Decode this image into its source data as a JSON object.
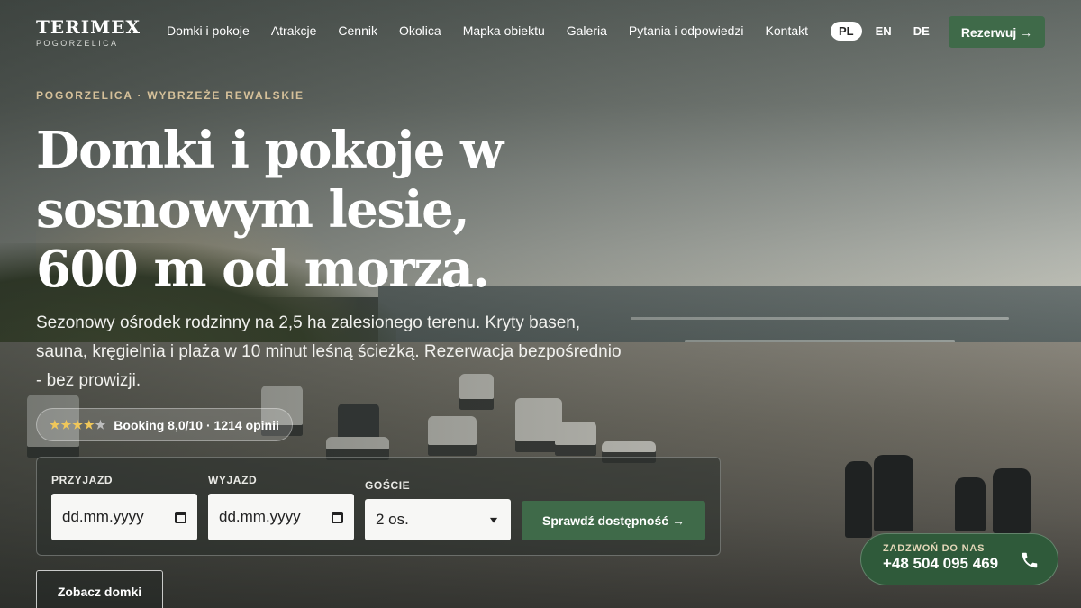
{
  "brand": {
    "name": "TERIMEX",
    "subtitle": "POGORZELICA"
  },
  "nav": {
    "items": [
      "Domki i pokoje",
      "Atrakcje",
      "Cennik",
      "Okolica",
      "Mapka obiektu",
      "Galeria",
      "Pytania i odpowiedzi",
      "Kontakt"
    ]
  },
  "languages": {
    "items": [
      "PL",
      "EN",
      "DE"
    ],
    "active": "PL"
  },
  "header": {
    "reserve_label": "Rezerwuj →"
  },
  "hero": {
    "eyebrow": "POGORZELICA · WYBRZEŻE REWALSKIE",
    "headline": [
      "Domki i pokoje w",
      "sosnowym lesie,",
      "600 m od morza."
    ],
    "lead": "Sezonowy ośrodek rodzinny na 2,5 ha zalesionego terenu. Kryty basen, sauna, kręgielnia i plaża w 10 minut leśną ścieżką. Rezerwacja bezpośrednio - bez prowizji.",
    "rating": {
      "stars_filled": 4,
      "stars_total": 5,
      "text": "Booking 8,0/10 · 1214 opinii"
    }
  },
  "booking": {
    "arrival": {
      "label": "PRZYJAZD",
      "placeholder": "dd.mm.yyyy"
    },
    "departure": {
      "label": "WYJAZD",
      "placeholder": "dd.mm.yyyy"
    },
    "guests": {
      "label": "GOŚCIE",
      "value": "2 os."
    },
    "submit_label": "Sprawdź dostępność →"
  },
  "secondary_cta": {
    "label": "Zobacz domki"
  },
  "call": {
    "label": "ZADZWOŃ DO NAS",
    "number": "+48 504 095 469"
  },
  "colors": {
    "accent_green": "#3f6a49",
    "eyebrow_gold": "#d6c19a",
    "star": "#f0c75a"
  }
}
